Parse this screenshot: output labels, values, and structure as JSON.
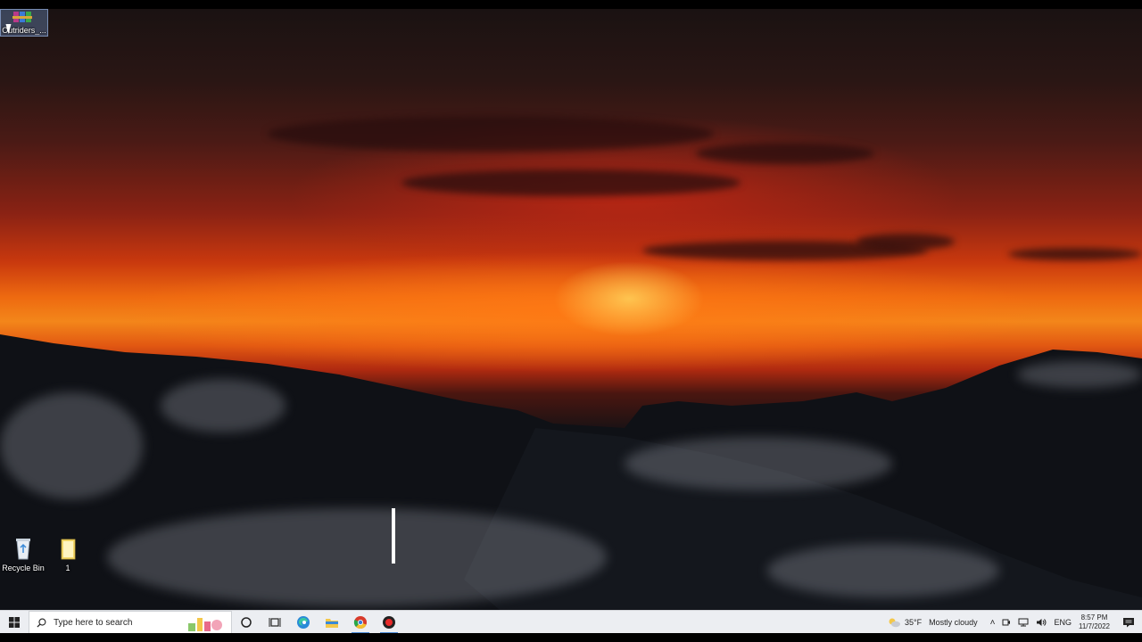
{
  "desktop": {
    "icons": [
      {
        "label": "Outriders_...",
        "icon": "winrar-archive-icon"
      },
      {
        "label": "Recycle Bin",
        "icon": "recycle-bin-icon"
      },
      {
        "label": "1",
        "icon": "folder-icon"
      }
    ]
  },
  "taskbar": {
    "search_placeholder": "Type here to search",
    "apps": [
      "cortana-icon",
      "task-view-icon",
      "edge-icon",
      "file-explorer-icon",
      "chrome-icon",
      "record-icon"
    ],
    "weather": {
      "temp": "35°F",
      "condition": "Mostly cloudy"
    },
    "language": "ENG",
    "time": "8:57 PM",
    "date": "11/7/2022"
  },
  "colors": {
    "taskbar_bg": "#eceef2",
    "accent": "#4a8ad8"
  }
}
